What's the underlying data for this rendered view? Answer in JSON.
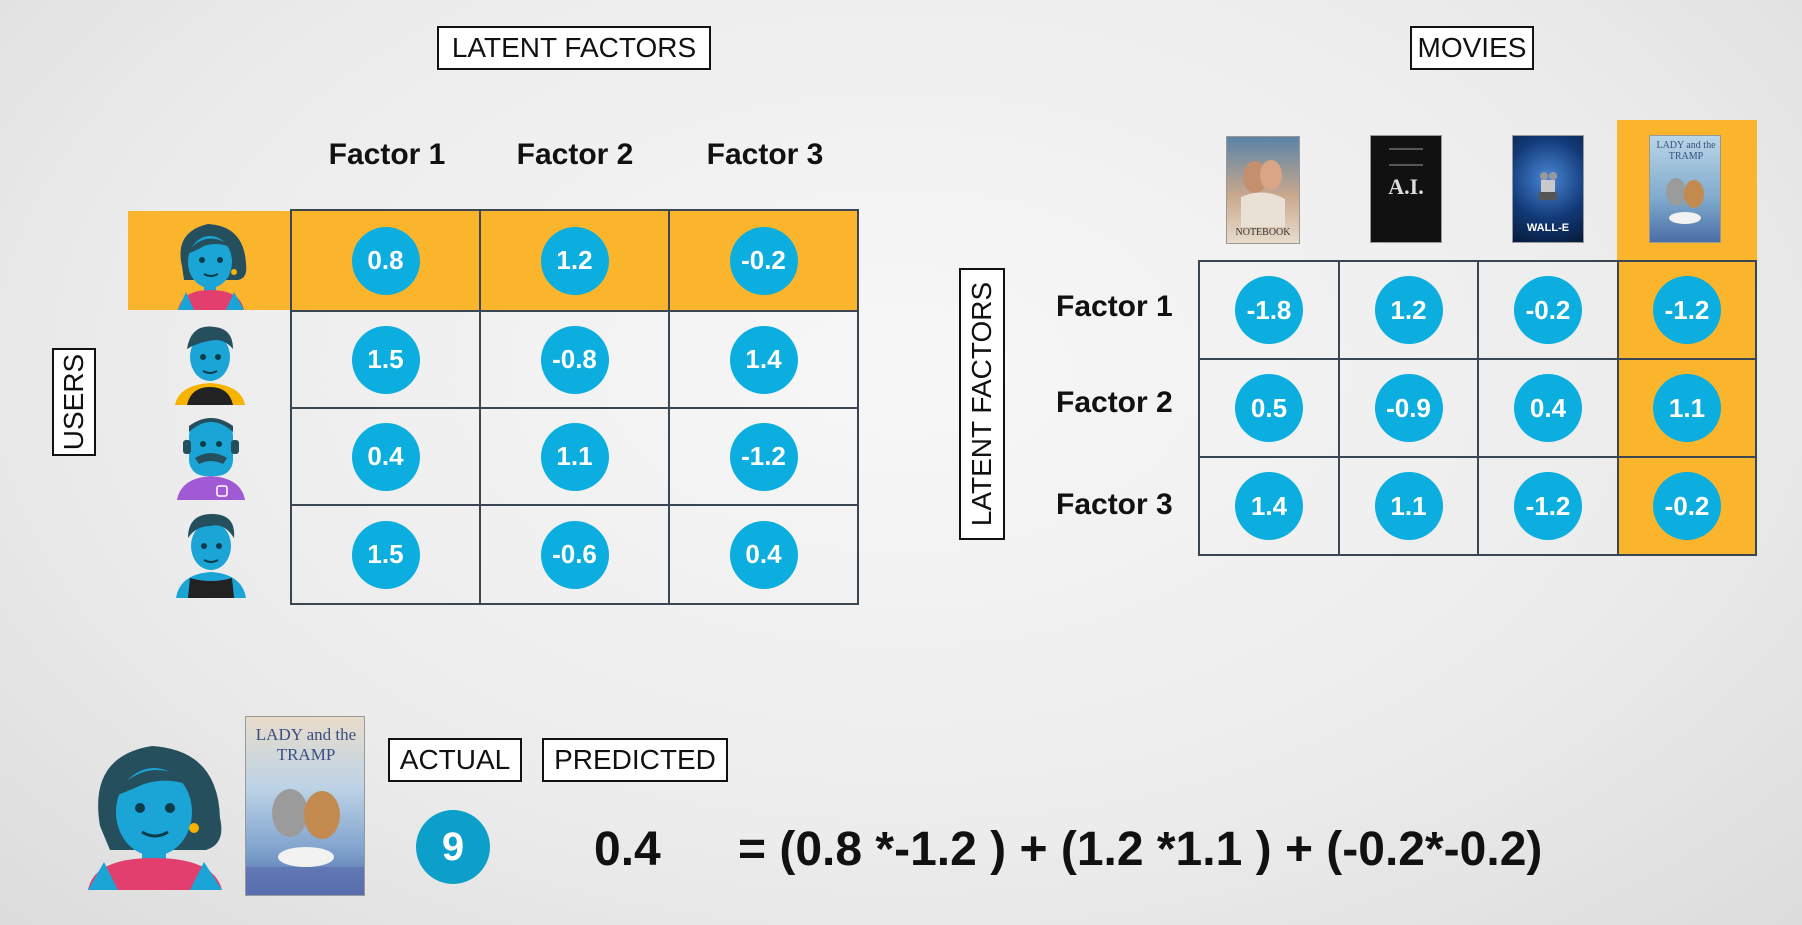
{
  "left": {
    "title": "LATENT FACTORS",
    "side_label": "USERS",
    "columns": [
      "Factor 1",
      "Factor 2",
      "Factor 3"
    ],
    "rows": [
      [
        "0.8",
        "1.2",
        "-0.2"
      ],
      [
        "1.5",
        "-0.8",
        "1.4"
      ],
      [
        "0.4",
        "1.1",
        "-1.2"
      ],
      [
        "1.5",
        "-0.6",
        "0.4"
      ]
    ],
    "highlight_row_index": 0
  },
  "right": {
    "title": "MOVIES",
    "side_label": "LATENT FACTORS",
    "row_labels": [
      "Factor 1",
      "Factor 2",
      "Factor 3"
    ],
    "rows": [
      [
        "-1.8",
        "1.2",
        "-0.2",
        "-1.2"
      ],
      [
        "0.5",
        "-0.9",
        "0.4",
        "1.1"
      ],
      [
        "1.4",
        "1.1",
        "-1.2",
        "-0.2"
      ]
    ],
    "posters": [
      {
        "name": "notebook-poster",
        "caption": "NOTEBOOK",
        "bg": "#b8a58f"
      },
      {
        "name": "ai-poster",
        "caption": "A.I.",
        "bg": "#111111"
      },
      {
        "name": "walle-poster",
        "caption": "WALL-E",
        "bg": "#123a78"
      },
      {
        "name": "lady-tramp-poster",
        "caption": "LADY and the TRAMP",
        "bg": "#6f9ec6"
      }
    ],
    "highlight_col_index": 3
  },
  "bottom": {
    "actual_label": "ACTUAL",
    "predicted_label": "PREDICTED",
    "actual_value": "9",
    "predicted_value": "0.4",
    "equation": "= (0.8 *-1.2 ) + (1.2 *1.1 ) + (-0.2*-0.2)",
    "poster_caption": "LADY and the TRAMP"
  },
  "colors": {
    "highlight": "#fbb52c",
    "bubble": "#0baede",
    "avatar_skin": "#1aa5d6",
    "grid_border": "#3b4653"
  }
}
